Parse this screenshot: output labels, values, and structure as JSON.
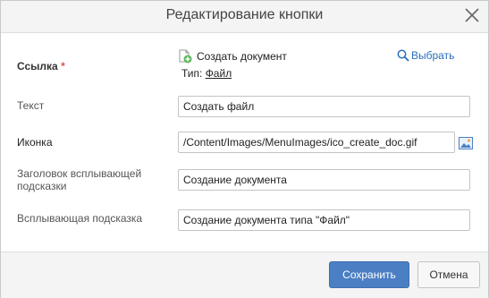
{
  "dialog": {
    "title": "Редактирование кнопки"
  },
  "form": {
    "link": {
      "label": "Ссылка",
      "required_mark": "*",
      "create_doc_text": "Создать документ",
      "type_prefix": "Тип:",
      "type_value": "Файл",
      "select_label": "Выбрать"
    },
    "text": {
      "label": "Текст",
      "value": "Создать файл"
    },
    "icon": {
      "label": "Иконка",
      "value": "/Content/Images/MenuImages/ico_create_doc.gif"
    },
    "tooltip_title": {
      "label": "Заголовок всплывающей подсказки",
      "value": "Создание документа"
    },
    "tooltip": {
      "label": "Всплывающая подсказка",
      "value": "Создание документа типа \"Файл\""
    }
  },
  "footer": {
    "save_label": "Сохранить",
    "cancel_label": "Отмена"
  },
  "colors": {
    "primary_button": "#4a7fc4",
    "link": "#2a6ebb",
    "required": "#d9534f",
    "create_icon_green": "#5cb85c"
  },
  "icons": [
    "close-icon",
    "create-document-icon",
    "search-icon",
    "image-picker-icon"
  ]
}
